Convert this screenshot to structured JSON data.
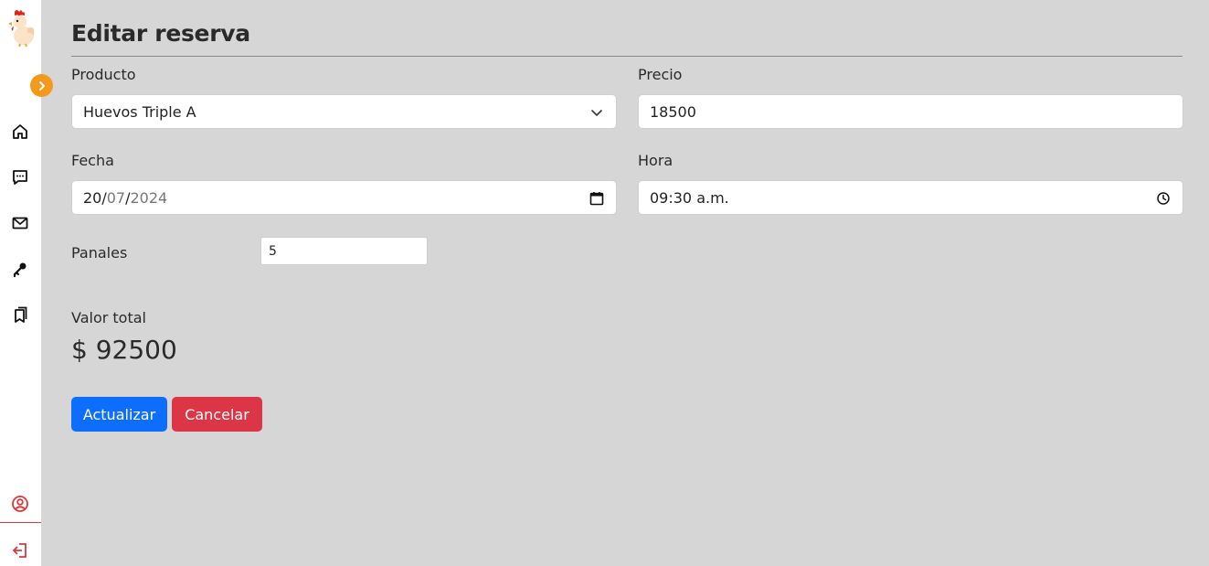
{
  "form": {
    "title": "Editar reserva",
    "producto": {
      "label": "Producto",
      "value": "Huevos Triple A"
    },
    "precio": {
      "label": "Precio",
      "value": "18500"
    },
    "fecha": {
      "label": "Fecha",
      "day": "20",
      "month": "07",
      "year": "2024",
      "sep": "/"
    },
    "hora": {
      "label": "Hora",
      "value": "09:30 a.m."
    },
    "panales": {
      "label": "Panales",
      "value": "5"
    },
    "total": {
      "label": "Valor total",
      "value": "$ 92500"
    },
    "buttons": {
      "update": "Actualizar",
      "cancel": "Cancelar"
    }
  },
  "colors": {
    "accent_orange": "#f39a1c",
    "primary": "#0d6efd",
    "danger": "#dc3545",
    "logout_red": "#d63a3a"
  }
}
